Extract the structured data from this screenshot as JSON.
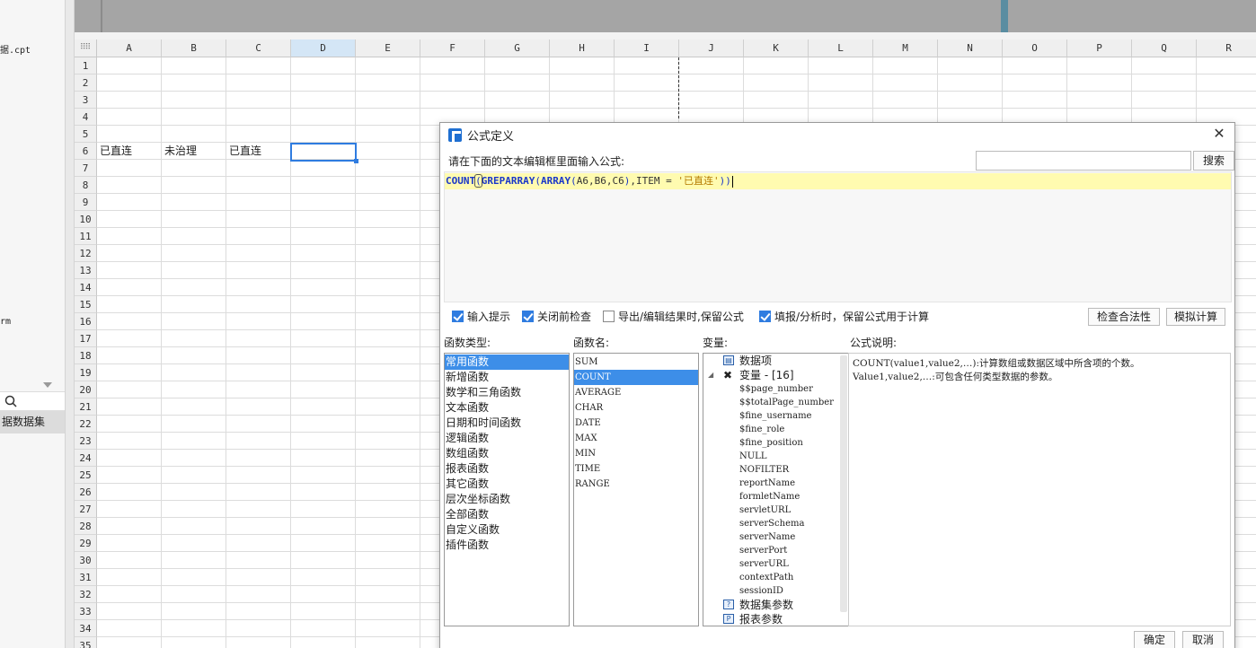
{
  "left_panel": {
    "file_label": "据.cpt",
    "item_label": "rm",
    "dataset_label": "据数据集"
  },
  "sheet": {
    "columns": [
      "A",
      "B",
      "C",
      "D",
      "E",
      "F",
      "G",
      "H",
      "I",
      "J",
      "K",
      "L",
      "M",
      "N",
      "O",
      "P",
      "Q",
      "R"
    ],
    "rows": [
      "1",
      "2",
      "3",
      "4",
      "5",
      "6",
      "7",
      "8",
      "9",
      "10",
      "11",
      "12",
      "13",
      "14",
      "15",
      "16",
      "17",
      "18",
      "19",
      "20",
      "21",
      "22",
      "23",
      "24",
      "25",
      "26",
      "27",
      "28",
      "29",
      "30",
      "31",
      "32",
      "33",
      "34",
      "35"
    ],
    "selected_column": "D",
    "selected_cell": "D6",
    "cells": {
      "A6": "已直连",
      "B6": "未治理",
      "C6": "已直连"
    }
  },
  "dialog": {
    "title": "公式定义",
    "prompt": "请在下面的文本编辑框里面输入公式:",
    "search_value": "",
    "search_button": "搜索",
    "formula": {
      "full": "COUNT(GREPARRAY(ARRAY(A6,B6,C6),ITEM = '已直连'))",
      "fn1": "COUNT",
      "p1": "(",
      "fn2": "GREPARRAY",
      "p2": "(",
      "fn3": "ARRAY",
      "p3": "(",
      "refs": "A6,B6,C6",
      "p4": ")",
      "cond": ",ITEM = ",
      "str": "'已直连'",
      "p5": "))"
    },
    "options": [
      {
        "label": "输入提示",
        "checked": true
      },
      {
        "label": "关闭前检查",
        "checked": true
      },
      {
        "label": "导出/编辑结果时,保留公式",
        "checked": false
      },
      {
        "label": "填报/分析时，保留公式用于计算",
        "checked": true
      }
    ],
    "check_button": "检查合法性",
    "simulate_button": "模拟计算",
    "func_type_label": "函数类型:",
    "func_name_label": "函数名:",
    "variable_label": "变量:",
    "desc_label": "公式说明:",
    "func_types": [
      "常用函数",
      "新增函数",
      "数学和三角函数",
      "文本函数",
      "日期和时间函数",
      "逻辑函数",
      "数组函数",
      "报表函数",
      "其它函数",
      "层次坐标函数",
      "全部函数",
      "自定义函数",
      "插件函数"
    ],
    "func_types_selected": "常用函数",
    "func_names": [
      "SUM",
      "COUNT",
      "AVERAGE",
      "CHAR",
      "DATE",
      "MAX",
      "MIN",
      "TIME",
      "RANGE"
    ],
    "func_names_selected": "COUNT",
    "variables": {
      "data_item": "数据项",
      "variable_group": "变量 - [16]",
      "items": [
        "$$page_number",
        "$$totalPage_number",
        "$fine_username",
        "$fine_role",
        "$fine_position",
        "NULL",
        "NOFILTER",
        "reportName",
        "formletName",
        "servletURL",
        "serverSchema",
        "serverName",
        "serverPort",
        "serverURL",
        "contextPath",
        "sessionID"
      ],
      "dataset_params": "数据集参数",
      "report_params": "报表参数"
    },
    "description": {
      "line1": "COUNT(value1,value2,…):计算数组或数据区域中所含项的个数。",
      "line2": "Value1,value2,…:可包含任何类型数据的参数。"
    },
    "ok_button": "确定",
    "cancel_button": "取消"
  },
  "colors": {
    "accent": "#2f7ce0",
    "selected_list": "#3d8ee8",
    "editor_highlight": "#fffbb0",
    "function_blue": "#1a37c9",
    "string_orange": "#b57a00"
  }
}
